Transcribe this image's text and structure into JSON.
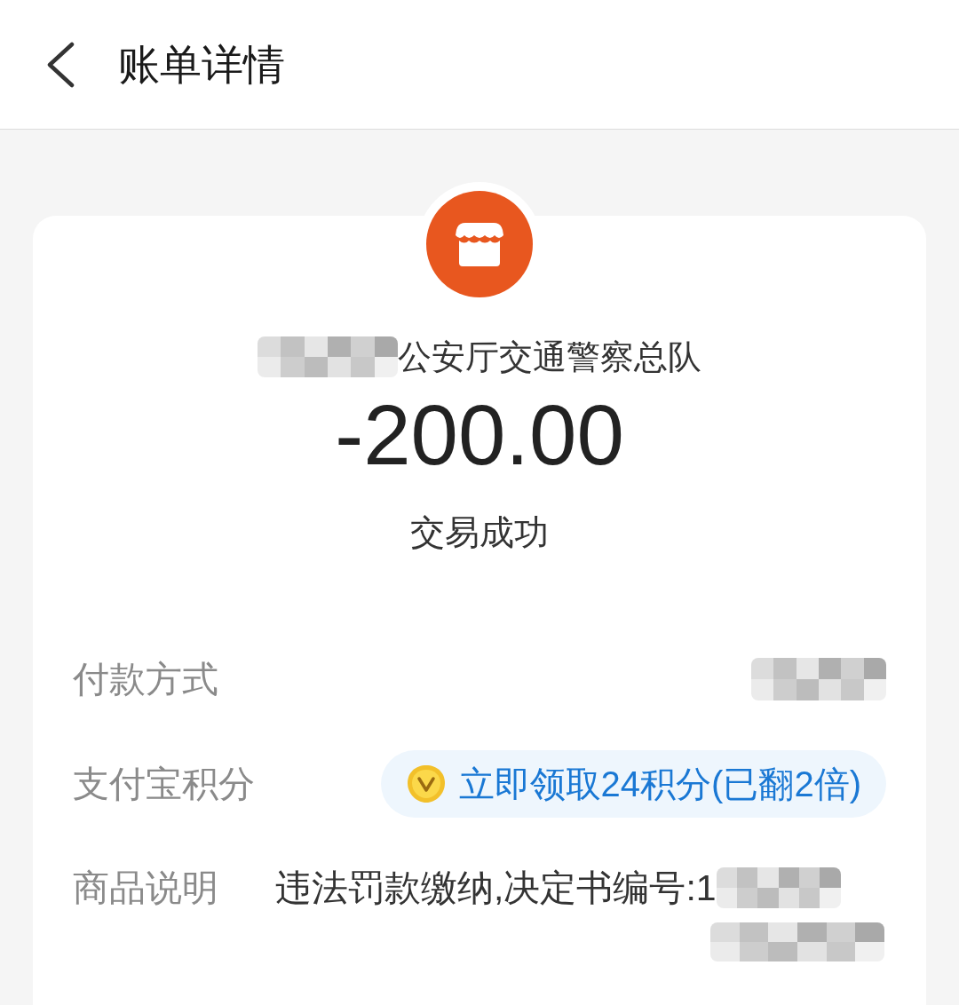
{
  "header": {
    "title": "账单详情"
  },
  "merchant": {
    "name": "公安厅交通警察总队",
    "redacted": true
  },
  "amount": "-200.00",
  "status": "交易成功",
  "details": [
    {
      "kind": "hidden",
      "label": "付款方式"
    },
    {
      "kind": "points",
      "label": "支付宝积分",
      "value": "立即领取24积分(已翻2倍)"
    },
    {
      "kind": "text",
      "label": "商品说明",
      "value": "违法罚款缴纳,决定书编号:1",
      "redacted": true
    }
  ]
}
